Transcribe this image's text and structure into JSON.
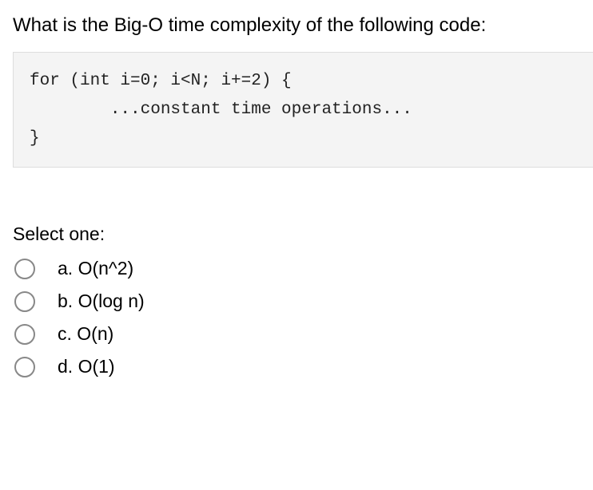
{
  "question": {
    "prompt": "What is the Big-O time complexity of the following code:",
    "code": "for (int i=0; i<N; i+=2) {\n        ...constant time operations...\n}",
    "selectLabel": "Select one:",
    "options": [
      {
        "letter": "a.",
        "text": "O(n^2)"
      },
      {
        "letter": "b.",
        "text": "O(log n)"
      },
      {
        "letter": "c.",
        "text": "O(n)"
      },
      {
        "letter": "d.",
        "text": "O(1)"
      }
    ]
  }
}
